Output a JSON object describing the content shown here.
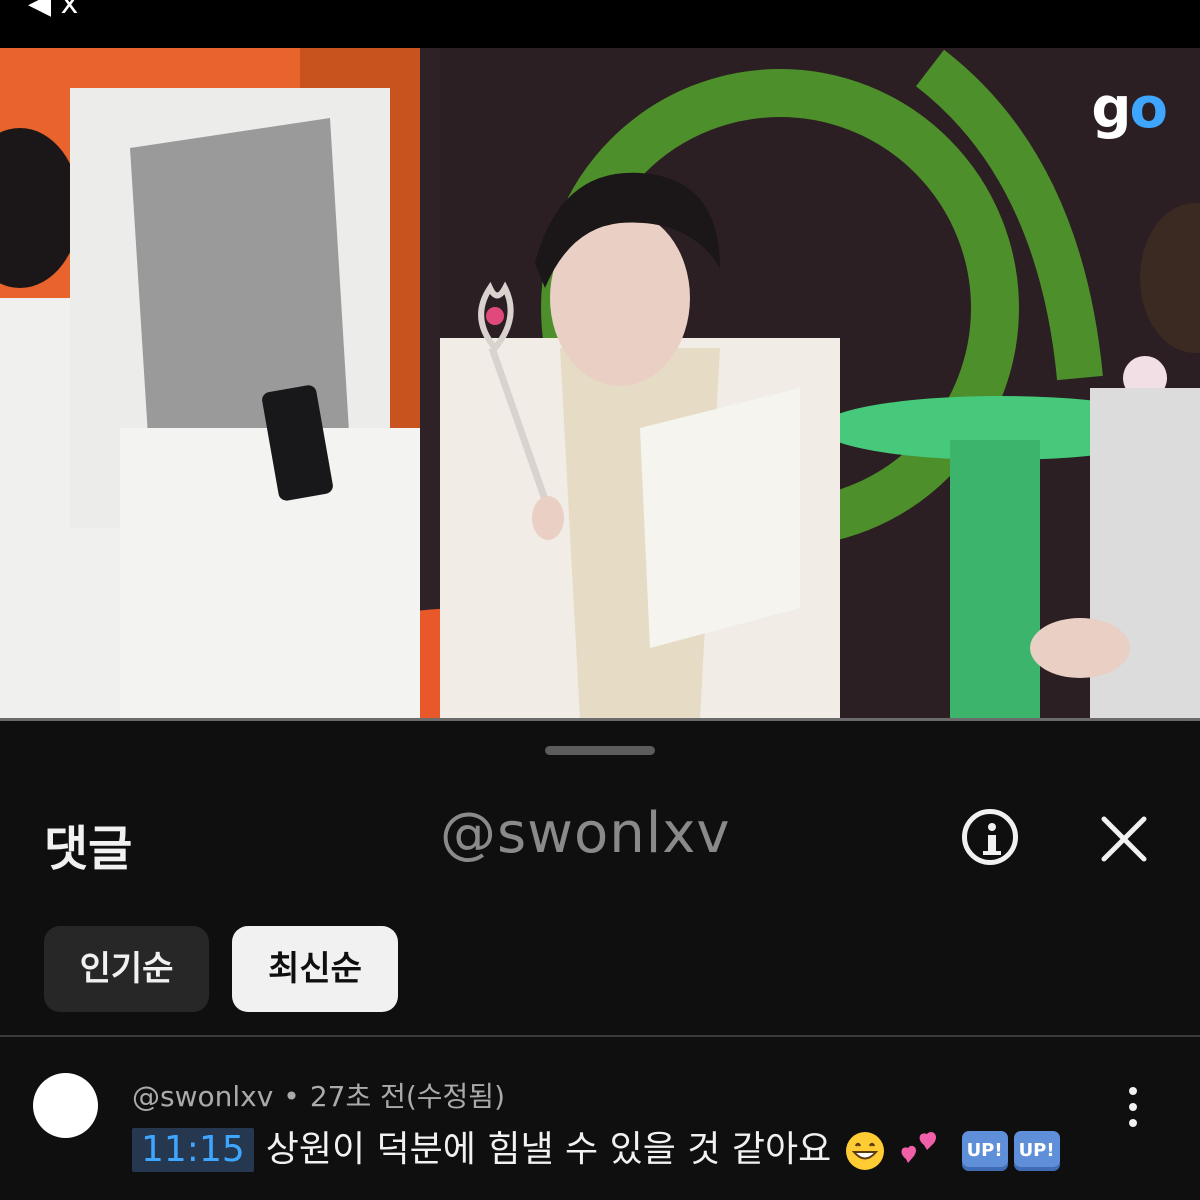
{
  "status_bar": {
    "glyph": "◀ x"
  },
  "video": {
    "channel_logo": {
      "g": "g",
      "o": "o"
    },
    "show_logo_text": "",
    "progress_fraction": 1.0
  },
  "comments_sheet": {
    "title": "댓글",
    "watermark": "@swonlxv",
    "info_icon": "info-icon",
    "close_icon": "close-icon",
    "sort_chips": [
      {
        "label": "인기순",
        "selected": false
      },
      {
        "label": "최신순",
        "selected": true
      }
    ],
    "comment": {
      "author": "@swonlxv",
      "separator": "•",
      "time": "27초 전(수정됨)",
      "timestamp_link": "11:15",
      "text": "상원이 덕분에 힘낼 수 있을 것 같아요",
      "emojis": [
        "grinning-face",
        "two-hearts"
      ],
      "badges": [
        "UP!",
        "UP!"
      ]
    }
  },
  "colors": {
    "background": "#0f0f0f",
    "chip_selected": "#f1f1f1",
    "chip_unselected": "#272727",
    "link_blue": "#3ea6ff",
    "secondary_text": "#aaaaaa"
  }
}
